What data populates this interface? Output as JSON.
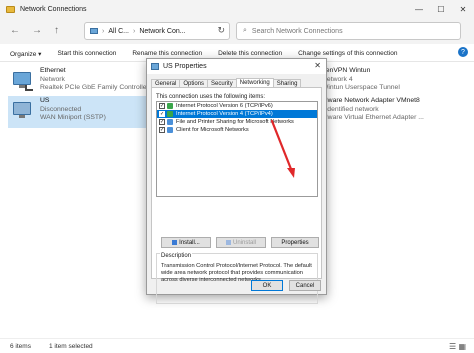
{
  "window": {
    "title": "Network Connections",
    "controls": {
      "minimize": "—",
      "maximize": "☐",
      "close": "✕"
    }
  },
  "nav": {
    "back": "←",
    "forward": "→",
    "up": "↑",
    "breadcrumb": [
      "All C...",
      "Network Con..."
    ],
    "search_placeholder": "Search Network Connections"
  },
  "commandbar": {
    "items": [
      "Organize ▾",
      "Start this connection",
      "Rename this connection",
      "Delete this connection",
      "Change settings of this connection"
    ],
    "more": "»"
  },
  "connections": [
    {
      "name": "Ethernet",
      "status": "Network",
      "device": "Realtek PCIe GbE Family Controller"
    },
    {
      "name": "US",
      "status": "Disconnected",
      "device": "WAN Miniport (SSTP)"
    }
  ],
  "right_connections": [
    {
      "name": "penVPN Wintun",
      "status": "Network 4",
      "device": "Wintun Userspace Tunnel"
    },
    {
      "name": "Mware Network Adapter VMnet8",
      "status": "nidentified network",
      "device": "Mware Virtual Ethernet Adapter ..."
    }
  ],
  "status": {
    "items": "6 items",
    "selected": "1 item selected"
  },
  "dialog": {
    "title": "US Properties",
    "tabs": [
      "General",
      "Options",
      "Security",
      "Networking",
      "Sharing"
    ],
    "active_tab": "Networking",
    "uses_label": "This connection uses the following items:",
    "items": [
      {
        "label": "Internet Protocol Version 6 (TCP/IPv6)",
        "checked": true,
        "selected": false
      },
      {
        "label": "Internet Protocol Version 4 (TCP/IPv4)",
        "checked": true,
        "selected": true
      },
      {
        "label": "File and Printer Sharing for Microsoft Networks",
        "checked": true,
        "selected": false
      },
      {
        "label": "Client for Microsoft Networks",
        "checked": true,
        "selected": false
      }
    ],
    "buttons": {
      "install": "Install...",
      "uninstall": "Uninstall",
      "properties": "Properties"
    },
    "description_label": "Description",
    "description": "Transmission Control Protocol/Internet Protocol. The default wide area network protocol that provides communication across diverse interconnected networks.",
    "ok": "OK",
    "cancel": "Cancel"
  },
  "colors": {
    "accent": "#0078d7",
    "selection": "#cce4f7",
    "annotation_arrow": "#e0282a"
  }
}
